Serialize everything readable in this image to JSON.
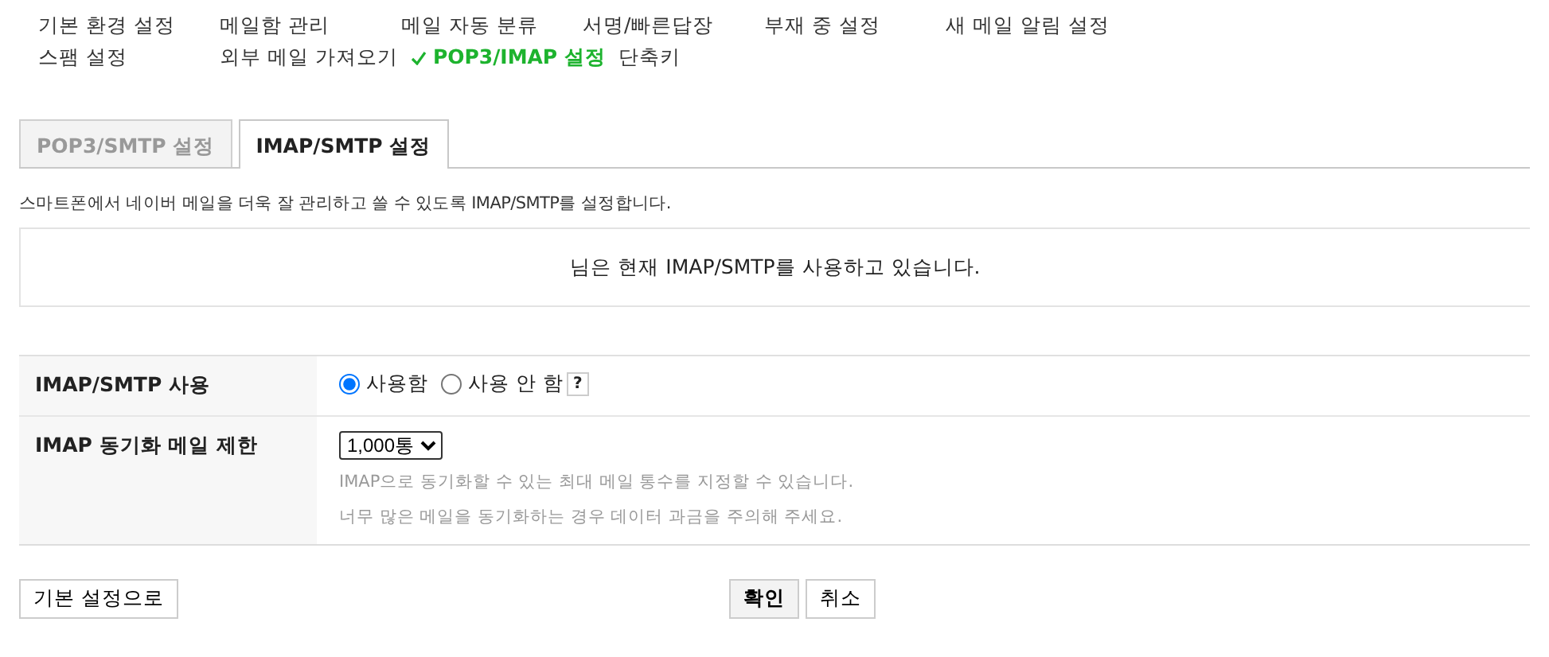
{
  "menu_rows": [
    [
      {
        "label": "기본 환경 설정",
        "selected": false
      },
      {
        "label": "메일함 관리",
        "selected": false
      },
      {
        "label": "메일 자동 분류",
        "selected": false
      },
      {
        "label": "서명/빠른답장",
        "selected": false
      },
      {
        "label": "부재 중 설정",
        "selected": false
      },
      {
        "label": "새 메일 알림 설정",
        "selected": false
      }
    ],
    [
      {
        "label": "스팸 설정",
        "selected": false
      },
      {
        "label": "외부 메일 가져오기",
        "selected": false
      },
      {
        "label": "POP3/IMAP 설정",
        "selected": true
      },
      {
        "label": "단축키",
        "selected": false
      }
    ]
  ],
  "tabs": [
    {
      "label": "POP3/SMTP 설정",
      "selected": false
    },
    {
      "label": "IMAP/SMTP 설정",
      "selected": true
    }
  ],
  "description": "스마트폰에서 네이버 메일을 더욱 잘 관리하고 쓸 수 있도록 IMAP/SMTP를 설정합니다.",
  "status_message": "님은 현재 IMAP/SMTP를 사용하고 있습니다.",
  "settings": [
    {
      "kind": "radio",
      "label": "IMAP/SMTP 사용",
      "options": [
        {
          "label": "사용함",
          "selected": true
        },
        {
          "label": "사용 안 함",
          "selected": false
        }
      ],
      "help": "?"
    },
    {
      "kind": "select",
      "label": "IMAP 동기화 메일 제한",
      "value": "1,000통",
      "notes": [
        "IMAP으로 동기화할 수 있는 최대 메일 통수를 지정할 수 있습니다.",
        "너무 많은 메일을 동기화하는 경우 데이터 과금을 주의해 주세요."
      ]
    }
  ],
  "buttons": {
    "reset": "기본 설정으로",
    "confirm": "확인",
    "cancel": "취소"
  }
}
